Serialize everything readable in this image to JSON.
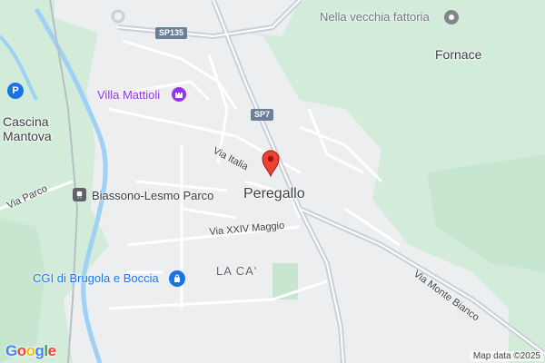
{
  "map": {
    "places": {
      "fornace": "Fornace",
      "cascina_line1": "Cascina",
      "cascina_line2": "Mantova",
      "peregallo": "Peregallo",
      "la_ca": "LA CA'"
    },
    "pois": {
      "villa_mattioli": "Villa Mattioli",
      "nella_vecchia_fattoria": "Nella vecchia fattoria",
      "cgi_brugola": "CGI di Brugola e Boccia",
      "biassono_station": "Biassono-Lesmo Parco"
    },
    "streets": {
      "via_italia": "Via Italia",
      "via_xxiv_maggio": "Via XXIV Maggio",
      "via_parco": "Via Parco",
      "via_monte_bianco": "Via Monte Bianco"
    },
    "route_shields": {
      "sp135": "SP135",
      "sp7": "SP7"
    },
    "attribution": {
      "logo": "Google",
      "map_data": "Map data ©2025"
    },
    "colors": {
      "park": "#cfe9d6",
      "urban": "#eceef0",
      "river": "#aadaff",
      "highway": "#c4cbd3",
      "marker": "#ea4335",
      "poi_purple": "#9334e6",
      "poi_blue": "#1a73e8"
    }
  }
}
